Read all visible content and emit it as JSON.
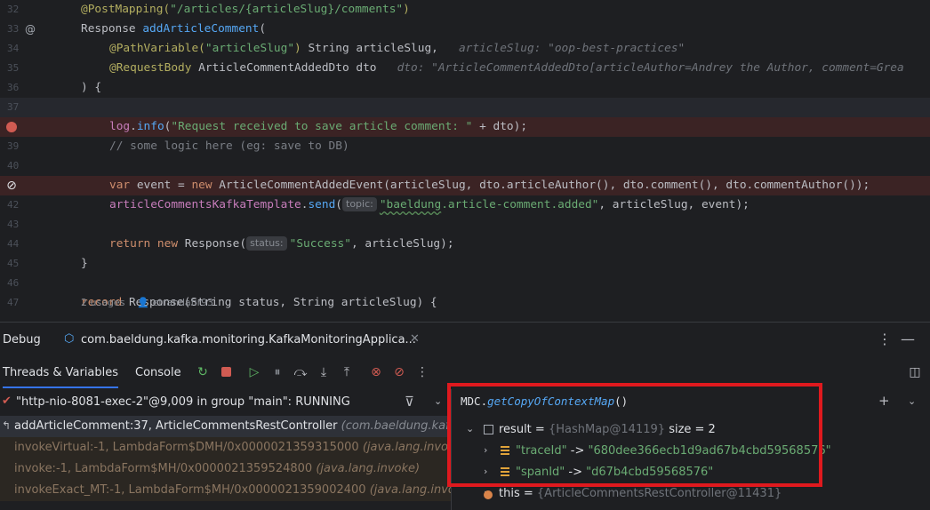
{
  "editor": {
    "lines": [
      {
        "num": "32",
        "segments": [
          {
            "c": "ann",
            "t": "@PostMapping("
          },
          {
            "c": "str",
            "t": "\"/articles/{articleSlug}/comments\""
          },
          {
            "c": "ann",
            "t": ")"
          }
        ],
        "indent": 3
      },
      {
        "num": "33",
        "gutter": "@",
        "segments": [
          {
            "c": "",
            "t": "Response "
          },
          {
            "c": "fn",
            "t": "addArticleComment"
          },
          {
            "c": "",
            "t": "("
          }
        ],
        "indent": 3
      },
      {
        "num": "34",
        "segments": [
          {
            "c": "ann",
            "t": "@PathVariable("
          },
          {
            "c": "str",
            "t": "\"articleSlug\""
          },
          {
            "c": "ann",
            "t": ")"
          },
          {
            "c": "",
            "t": " String articleSlug,   "
          },
          {
            "c": "inl",
            "t": "articleSlug: \"oop-best-practices\""
          }
        ],
        "indent": 5
      },
      {
        "num": "35",
        "segments": [
          {
            "c": "ann",
            "t": "@RequestBody"
          },
          {
            "c": "",
            "t": " ArticleCommentAddedDto dto   "
          },
          {
            "c": "inl",
            "t": "dto: \"ArticleCommentAddedDto[articleAuthor=Andrey the Author, comment=Grea"
          }
        ],
        "indent": 5
      },
      {
        "num": "36",
        "segments": [
          {
            "c": "",
            "t": ") {"
          }
        ],
        "indent": 3
      },
      {
        "num": "37",
        "segments": [],
        "indent": 3
      },
      {
        "num": "",
        "gutter": "bp",
        "segments": [
          {
            "c": "fld",
            "t": "log"
          },
          {
            "c": "",
            "t": "."
          },
          {
            "c": "fn",
            "t": "info"
          },
          {
            "c": "",
            "t": "("
          },
          {
            "c": "str",
            "t": "\"Request received to save article comment: \""
          },
          {
            "c": "",
            "t": " + dto);"
          }
        ],
        "indent": 5
      },
      {
        "num": "39",
        "segments": [
          {
            "c": "cm",
            "t": "// some logic here (eg: save to DB)"
          }
        ],
        "indent": 5
      },
      {
        "num": "40",
        "segments": [],
        "indent": 3
      },
      {
        "num": "",
        "gutter": "mute",
        "segments": [
          {
            "c": "kw",
            "t": "var"
          },
          {
            "c": "",
            "t": " event = "
          },
          {
            "c": "kw",
            "t": "new"
          },
          {
            "c": "",
            "t": " ArticleCommentAddedEvent(articleSlug, dto.articleAuthor(), dto.comment(), dto.commentAuthor());"
          }
        ],
        "indent": 5
      },
      {
        "num": "42",
        "segments": [
          {
            "c": "fld",
            "t": "articleCommentsKafkaTemplate"
          },
          {
            "c": "",
            "t": "."
          },
          {
            "c": "fn",
            "t": "send"
          },
          {
            "c": "",
            "t": "("
          },
          {
            "c": "hint",
            "t": "topic:"
          },
          {
            "c": "str squig",
            "t": "\"baeldung"
          },
          {
            "c": "str",
            "t": ".article-comment.added\""
          },
          {
            "c": "",
            "t": ", articleSlug, event);"
          }
        ],
        "indent": 5
      },
      {
        "num": "43",
        "segments": [],
        "indent": 3
      },
      {
        "num": "44",
        "segments": [
          {
            "c": "kw",
            "t": "return new"
          },
          {
            "c": "",
            "t": " Response("
          },
          {
            "c": "hint",
            "t": "status:"
          },
          {
            "c": "str",
            "t": "\"Success\""
          },
          {
            "c": "",
            "t": ", articleSlug);"
          }
        ],
        "indent": 5
      },
      {
        "num": "45",
        "segments": [
          {
            "c": "",
            "t": "}"
          }
        ],
        "indent": 3
      },
      {
        "num": "46",
        "segments": [],
        "indent": 3
      },
      {
        "num": "47",
        "segments": [
          {
            "c": "kw",
            "t": "record"
          },
          {
            "c": "",
            "t": " Response(String status, String articleSlug) {"
          }
        ],
        "indent": 3
      }
    ],
    "usages": {
      "count": "2 usages",
      "author": "etrandafir93"
    }
  },
  "debug": {
    "title": "Debug",
    "run_config": "com.baeldung.kafka.monitoring.KafkaMonitoringApplica...",
    "tabs": [
      "Threads & Variables",
      "Console"
    ]
  },
  "frames": {
    "thread": "\"http-nio-8081-exec-2\"@9,009 in group \"main\": RUNNING",
    "items": [
      {
        "method": "addArticleComment:37, ArticleCommentsRestController",
        "pkg": "(com.baeldung.kafka.",
        "kind": "sel"
      },
      {
        "method": "invokeVirtual:-1, LambdaForm$DMH/0x0000021359315000",
        "pkg": "(java.lang.invoke)",
        "kind": "lib"
      },
      {
        "method": "invoke:-1, LambdaForm$MH/0x0000021359524800",
        "pkg": "(java.lang.invoke)",
        "kind": "lib"
      },
      {
        "method": "invokeExact_MT:-1, LambdaForm$MH/0x0000021359002400",
        "pkg": "(java.lang.invoke)",
        "kind": "lib"
      }
    ]
  },
  "variables": {
    "expression_prefix": "MDC.",
    "expression_method": "getCopyOfContextMap",
    "expression_suffix": "()",
    "result_name": "result",
    "result_type": "{HashMap@14119}",
    "result_size": "size = 2",
    "entries": [
      {
        "key": "\"traceId\"",
        "value": "\"680dee366ecb1d9ad67b4cbd59568576\""
      },
      {
        "key": "\"spanId\"",
        "value": "\"d67b4cbd59568576\""
      }
    ],
    "this_name": "this",
    "this_type": "{ArticleCommentsRestController@11431}"
  },
  "colors": {
    "accent": "#3574f0",
    "highlight_box": "#e0191e",
    "breakpoint": "#d05b52"
  }
}
